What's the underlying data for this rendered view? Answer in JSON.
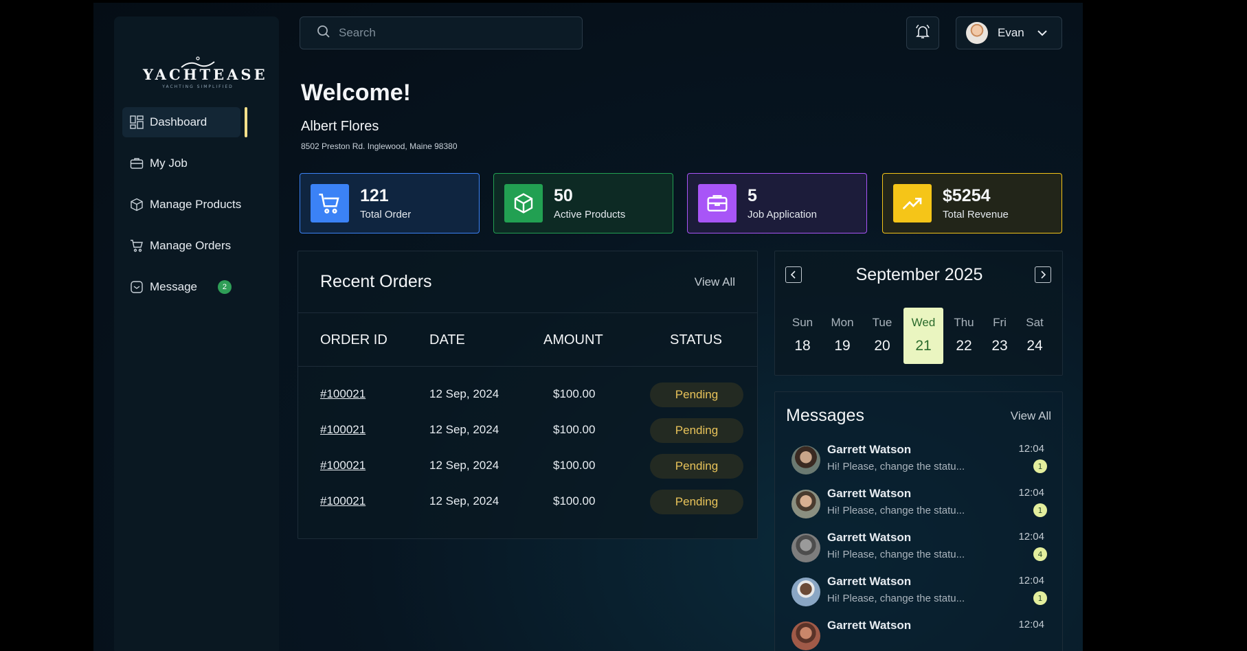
{
  "brand": {
    "name": "YACHTEASE",
    "tagline": "YACHTING SIMPLIFIED"
  },
  "sidebar": {
    "items": [
      {
        "label": "Dashboard",
        "icon": "dashboard-icon",
        "active": true
      },
      {
        "label": "My Job",
        "icon": "briefcase-icon"
      },
      {
        "label": "Manage Products",
        "icon": "box-icon"
      },
      {
        "label": "Manage Orders",
        "icon": "cart-icon"
      },
      {
        "label": "Message",
        "icon": "message-icon",
        "badge": "2"
      }
    ]
  },
  "header": {
    "search_placeholder": "Search",
    "user_name": "Evan"
  },
  "welcome": {
    "title": "Welcome!",
    "name": "Albert Flores",
    "address": "8502 Preston Rd. Inglewood, Maine 98380"
  },
  "stats": [
    {
      "value": "121",
      "label": "Total Order",
      "color": "#3b82f6",
      "icon": "cart-icon"
    },
    {
      "value": "50",
      "label": "Active Products",
      "color": "#22a052",
      "icon": "box-icon"
    },
    {
      "value": "5",
      "label": "Job Application",
      "color": "#a855f7",
      "icon": "briefcase-icon"
    },
    {
      "value": "$5254",
      "label": "Total Revenue",
      "color": "#f5c518",
      "icon": "trending-up-icon"
    }
  ],
  "orders": {
    "title": "Recent Orders",
    "view_all": "View All",
    "columns": [
      "ORDER ID",
      "DATE",
      "AMOUNT",
      "STATUS"
    ],
    "rows": [
      {
        "id": "#100021",
        "date": "12 Sep, 2024",
        "amount": "$100.00",
        "status": "Pending"
      },
      {
        "id": "#100021",
        "date": "12 Sep, 2024",
        "amount": "$100.00",
        "status": "Pending"
      },
      {
        "id": "#100021",
        "date": "12 Sep, 2024",
        "amount": "$100.00",
        "status": "Pending"
      },
      {
        "id": "#100021",
        "date": "12 Sep, 2024",
        "amount": "$100.00",
        "status": "Pending"
      }
    ]
  },
  "calendar": {
    "month": "September 2025",
    "days": [
      {
        "name": "Sun",
        "date": "18"
      },
      {
        "name": "Mon",
        "date": "19"
      },
      {
        "name": "Tue",
        "date": "20"
      },
      {
        "name": "Wed",
        "date": "21",
        "selected": true
      },
      {
        "name": "Thu",
        "date": "22"
      },
      {
        "name": "Fri",
        "date": "23"
      },
      {
        "name": "Sat",
        "date": "24"
      }
    ]
  },
  "messages": {
    "title": "Messages",
    "view_all": "View All",
    "items": [
      {
        "name": "Garrett Watson",
        "text": "Hi! Please, change the statu...",
        "time": "12:04",
        "unread": "1"
      },
      {
        "name": "Garrett Watson",
        "text": "Hi! Please, change the statu...",
        "time": "12:04",
        "unread": "1"
      },
      {
        "name": "Garrett Watson",
        "text": "Hi! Please, change the statu...",
        "time": "12:04",
        "unread": "4"
      },
      {
        "name": "Garrett Watson",
        "text": "Hi! Please, change the statu...",
        "time": "12:04",
        "unread": "1"
      },
      {
        "name": "Garrett Watson",
        "text": "",
        "time": "12:04",
        "unread": ""
      }
    ]
  }
}
